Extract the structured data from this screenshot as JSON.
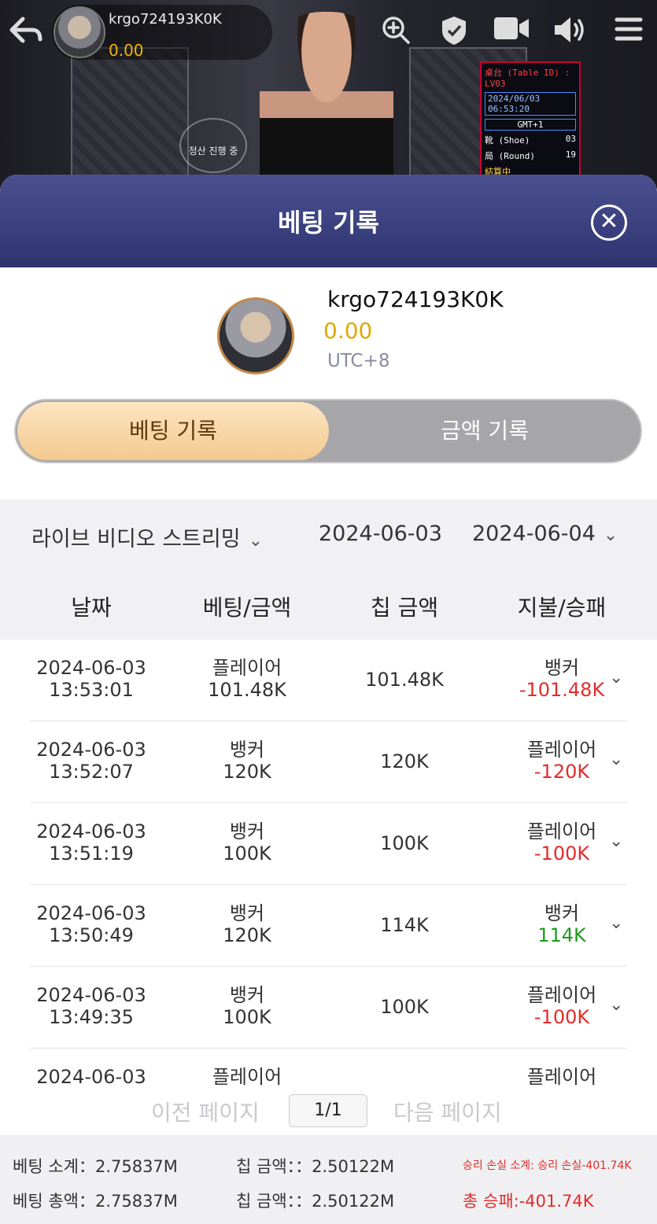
{
  "video": {
    "player_name": "krgo724193K0K",
    "player_balance": "0.00",
    "settlement_badge": "정산 진행 중",
    "table_info": {
      "title": "桌台 (Table ID) :  LV03",
      "datetime": "2024/06/03  06:53:20",
      "timezone": "GMT+1",
      "shoe_label": "靴 (Shoe)",
      "shoe_value": "03",
      "round_label": "局 (Round)",
      "round_value": "19",
      "settlement": "結算中 (Settlement...)"
    },
    "icons": [
      "back-icon",
      "zoom-icon",
      "shield-icon",
      "video-icon",
      "sound-icon",
      "menu-icon"
    ]
  },
  "modal": {
    "title": "베팅 기록",
    "close_glyph": "✕",
    "profile": {
      "username": "krgo724193K0K",
      "balance": "0.00",
      "timezone": "UTC+8"
    },
    "tabs": {
      "active": "베팅 기록",
      "inactive": "금액 기록"
    },
    "filters": {
      "game_type": "라이브 비디오 스트리밍",
      "start_date": "2024-06-03",
      "end_date": "2024-06-04"
    },
    "columns": [
      "날짜",
      "베팅/금액",
      "칩 금액",
      "지불/승패"
    ],
    "rows": [
      {
        "date": "2024-06-03",
        "time": "13:53:01",
        "bet": "플레이어",
        "amount": "101.48K",
        "chip": "101.48K",
        "result": "뱅커",
        "payout": "-101.48K",
        "payout_sign": "neg"
      },
      {
        "date": "2024-06-03",
        "time": "13:52:07",
        "bet": "뱅커",
        "amount": "120K",
        "chip": "120K",
        "result": "플레이어",
        "payout": "-120K",
        "payout_sign": "neg"
      },
      {
        "date": "2024-06-03",
        "time": "13:51:19",
        "bet": "뱅커",
        "amount": "100K",
        "chip": "100K",
        "result": "플레이어",
        "payout": "-100K",
        "payout_sign": "neg"
      },
      {
        "date": "2024-06-03",
        "time": "13:50:49",
        "bet": "뱅커",
        "amount": "120K",
        "chip": "114K",
        "result": "뱅커",
        "payout": "114K",
        "payout_sign": "pos"
      },
      {
        "date": "2024-06-03",
        "time": "13:49:35",
        "bet": "뱅커",
        "amount": "100K",
        "chip": "100K",
        "result": "플레이어",
        "payout": "-100K",
        "payout_sign": "neg"
      },
      {
        "date": "2024-06-03",
        "time": "",
        "bet": "플레이어",
        "amount": "",
        "chip": "",
        "result": "플레이어",
        "payout": "",
        "payout_sign": "neg"
      }
    ],
    "pager": {
      "prev": "이전 페이지",
      "current": "1/1",
      "next": "다음 페이지"
    },
    "summary": {
      "bet_subtotal": "베팅 소계：2.75837M",
      "chip_subtotal": "칩 금액：：2.50122M",
      "winloss_subtotal": "승리 손실 소계: 승리 손실-401.74K",
      "bet_total": "베팅 총액：2.75837M",
      "chip_total": "칩 금액：：2.50122M",
      "winloss_total": "총 승패:-401.74K"
    }
  },
  "colors": {
    "header_bg": "#3a3f7e",
    "tab_active_bg": "#f6d3a1",
    "balance_gold": "#e0a800",
    "loss_red": "#e52b2b",
    "win_green": "#1f9b1f"
  }
}
